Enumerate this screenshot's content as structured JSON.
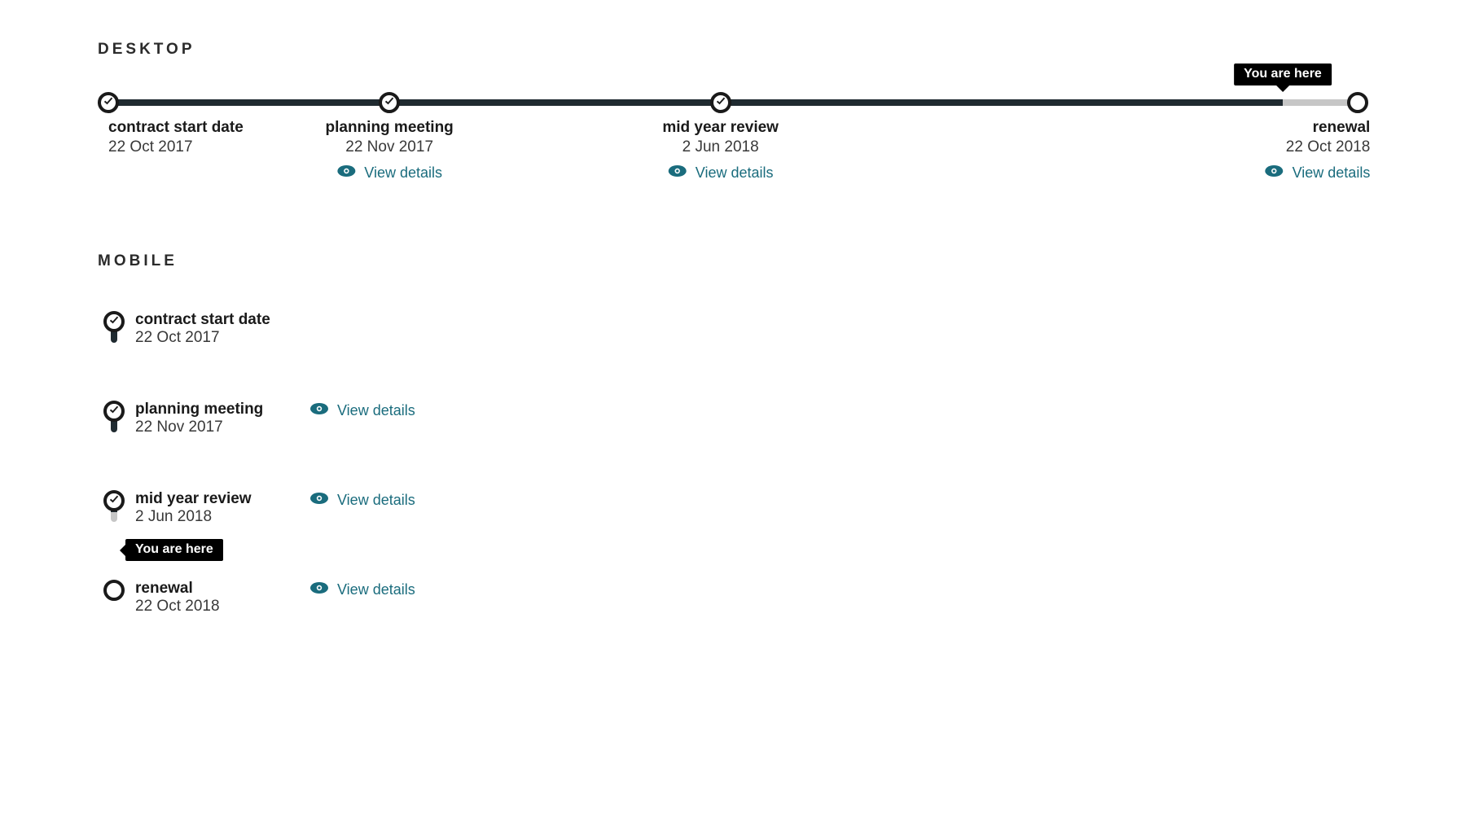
{
  "headings": {
    "desktop": "DESKTOP",
    "mobile": "MOBILE"
  },
  "marker_label": "You are here",
  "view_details_label": "View details",
  "progress_percent": 94,
  "milestones": [
    {
      "title": "contract start date",
      "date": "22 Oct 2017",
      "pos": 0,
      "done": true,
      "has_details": false
    },
    {
      "title": "planning meeting",
      "date": "22 Nov 2017",
      "pos": 22.5,
      "done": true,
      "has_details": true
    },
    {
      "title": "mid year review",
      "date": "2 Jun 2018",
      "pos": 49,
      "done": true,
      "has_details": true
    },
    {
      "title": "renewal",
      "date": "22 Oct 2018",
      "pos": 100,
      "done": false,
      "has_details": true
    }
  ]
}
